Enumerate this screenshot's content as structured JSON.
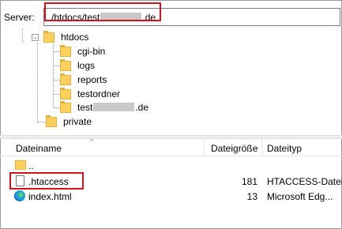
{
  "server_bar": {
    "label": "Server:",
    "path_prefix": "/htdocs/test",
    "path_suffix": ".de"
  },
  "tree": {
    "htdocs": "htdocs",
    "children": [
      "cgi-bin",
      "logs",
      "reports",
      "testordner"
    ],
    "blurred_child_prefix": "test",
    "blurred_child_suffix": ".de",
    "private": "private"
  },
  "file_list": {
    "columns": {
      "name": "Dateiname",
      "size": "Dateigröße",
      "type": "Dateityp"
    },
    "rows": [
      {
        "name": "..",
        "size": "",
        "type": "",
        "icon": "folder-icon"
      },
      {
        "name": ".htaccess",
        "size": "181",
        "type": "HTACCESS-Datei",
        "icon": "document-icon"
      },
      {
        "name": "index.html",
        "size": "13",
        "type": "Microsoft Edg...",
        "icon": "edge-icon"
      }
    ]
  },
  "colors": {
    "highlight": "#d4141c",
    "folder": "#ffd15c"
  }
}
